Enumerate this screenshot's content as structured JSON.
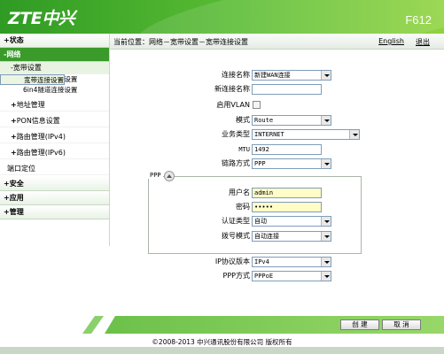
{
  "header": {
    "logo": "ZTE中兴",
    "model": "F612"
  },
  "breadcrumb": "当前位置：网络－宽带设置－宽带连接设置",
  "top_links": {
    "language": "English",
    "logout": "退出"
  },
  "sidebar": {
    "status": "状态",
    "network": "网络",
    "broadband": "宽带设置",
    "broadband_conn": "宽带连接设置",
    "4in6": "4in6隧道连接设置",
    "6in4": "6in4隧道连接设置",
    "address": "地址管理",
    "pon": "PON信息设置",
    "route_v4": "路由管理(IPv4)",
    "route_v6": "路由管理(IPv6)",
    "port_locate": "端口定位",
    "security": "安全",
    "app": "应用",
    "manage": "管理"
  },
  "form": {
    "conn_name_label": "连接名称",
    "conn_name_value": "新建WAN连接",
    "new_conn_label": "新连接名称",
    "new_conn_value": "",
    "vlan_label": "启用VLAN",
    "mode_label": "模式",
    "mode_value": "Route",
    "service_label": "业务类型",
    "service_value": "INTERNET",
    "mtu_label": "MTU",
    "mtu_value": "1492",
    "link_label": "链路方式",
    "link_value": "PPP",
    "ppp_title": "PPP",
    "user_label": "用户名",
    "user_value": "admin",
    "pass_label": "密码",
    "pass_value": "•••••",
    "auth_label": "认证类型",
    "auth_value": "自动",
    "dial_label": "拨号模式",
    "dial_value": "自动连接",
    "ipver_label": "IP协议版本",
    "ipver_value": "IPv4",
    "pppmode_label": "PPP方式",
    "pppmode_value": "PPPoE"
  },
  "buttons": {
    "create": "创 建",
    "cancel": "取 消"
  },
  "footer": {
    "copyright": "©2008-2013 中兴通讯股份有限公司 版权所有"
  },
  "colors": {
    "brand_green": "#3a9a2a",
    "header_light": "#8fd33e",
    "field_highlight": "#fffcc8"
  }
}
